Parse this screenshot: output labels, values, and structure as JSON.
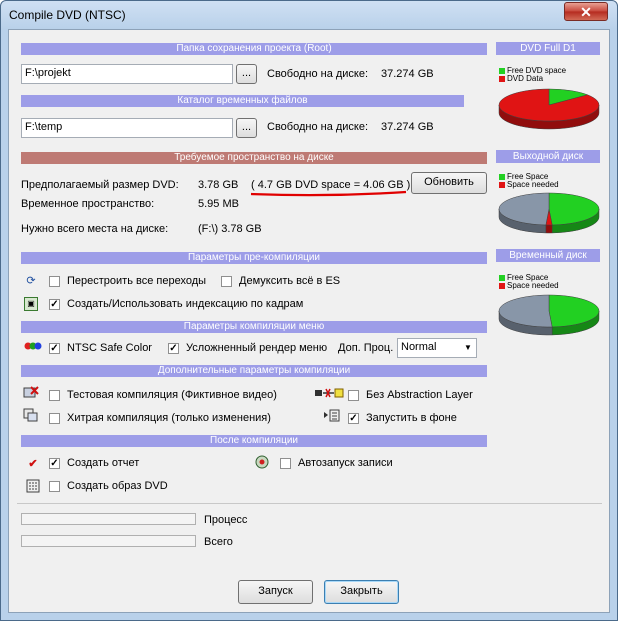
{
  "window": {
    "title": "Compile DVD (NTSC)",
    "close_glyph": "✕"
  },
  "root": {
    "header": "Папка сохранения проекта (Root)",
    "path": "F:\\projekt",
    "browse": "...",
    "free_label": "Свободно на диске:",
    "free_value": "37.274 GB"
  },
  "temp": {
    "header": "Каталог временных файлов",
    "path": "F:\\temp",
    "browse": "...",
    "free_label": "Свободно на диске:",
    "free_value": "37.274 GB"
  },
  "space": {
    "header": "Требуемое пространство на диске",
    "dvd_size_label": "Предполагаемый размер DVD:",
    "dvd_size_value": "3.78 GB",
    "dvd_space_note": "( 4.7 GB DVD space = 4.06 GB )",
    "refresh": "Обновить",
    "temp_label": "Временное пространство:",
    "temp_value": "5.95 MB",
    "total_label": "Нужно всего места на диске:",
    "total_value": "(F:\\) 3.78 GB"
  },
  "precompile": {
    "header": "Параметры пре-компиляции",
    "rebuild": "Перестроить все переходы",
    "rebuild_checked": false,
    "demux": "Демуксить всё в ES",
    "demux_checked": false,
    "index": "Создать/Использовать индексацию по кадрам",
    "index_checked": true
  },
  "menu": {
    "header": "Параметры компиляции меню",
    "ntsc_safe": "NTSC Safe Color",
    "ntsc_safe_checked": true,
    "render": "Усложненный рендер меню",
    "render_checked": true,
    "proc_label": "Доп. Проц.",
    "proc_value": "Normal"
  },
  "extra": {
    "header": "Дополнительные параметры компиляции",
    "test": "Тестовая компиляция (Фиктивное видео)",
    "test_checked": false,
    "abstraction": "Без Abstraction Layer",
    "abstraction_checked": false,
    "smart": "Хитрая компиляция (только изменения)",
    "smart_checked": false,
    "background": "Запустить в фоне",
    "background_checked": true
  },
  "after": {
    "header": "После компиляции",
    "report": "Создать отчет",
    "report_checked": true,
    "autoburn": "Автозапуск записи",
    "autoburn_checked": false,
    "image": "Создать образ DVD",
    "image_checked": false
  },
  "progress": {
    "process_label": "Процесс",
    "process_value": 0,
    "total_label": "Всего",
    "total_value": 0
  },
  "buttons": {
    "start": "Запуск",
    "close": "Закрыть"
  },
  "side": {
    "dvd": {
      "header": "DVD Full D1",
      "legend": [
        "Free DVD space",
        "DVD Data"
      ],
      "colors": [
        "#22d022",
        "#e01414"
      ],
      "fractions": [
        0.14,
        0.86
      ]
    },
    "output": {
      "header": "Выходной диск",
      "legend": [
        "Free Space",
        "Space needed"
      ],
      "colors": [
        "#22d022",
        "#e01414"
      ],
      "fractions": [
        0.49,
        0.02
      ]
    },
    "tempdisk": {
      "header": "Временный диск",
      "legend": [
        "Free Space",
        "Space needed"
      ],
      "colors": [
        "#22d022",
        "#e01414"
      ],
      "fractions": [
        0.49,
        0.0
      ]
    },
    "used_color": "#8896a8",
    "annotation_color": "#e00000"
  }
}
